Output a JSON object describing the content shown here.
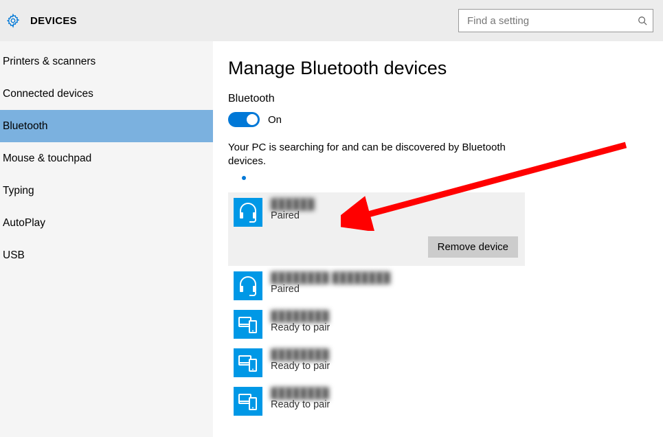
{
  "header": {
    "title": "DEVICES",
    "search_placeholder": "Find a setting"
  },
  "sidebar": {
    "items": [
      {
        "label": "Printers & scanners",
        "selected": false
      },
      {
        "label": "Connected devices",
        "selected": false
      },
      {
        "label": "Bluetooth",
        "selected": true
      },
      {
        "label": "Mouse & touchpad",
        "selected": false
      },
      {
        "label": "Typing",
        "selected": false
      },
      {
        "label": "AutoPlay",
        "selected": false
      },
      {
        "label": "USB",
        "selected": false
      }
    ]
  },
  "main": {
    "page_title": "Manage Bluetooth devices",
    "bluetooth_label": "Bluetooth",
    "toggle_state": "On",
    "status_text": "Your PC is searching for and can be discovered by Bluetooth devices.",
    "remove_label": "Remove device"
  },
  "devices": [
    {
      "name": "██████",
      "status": "Paired",
      "icon": "headset",
      "selected": true
    },
    {
      "name": "████████ ████████",
      "status": "Paired",
      "icon": "headset",
      "selected": false
    },
    {
      "name": "████████",
      "status": "Ready to pair",
      "icon": "phone",
      "selected": false
    },
    {
      "name": "████████",
      "status": "Ready to pair",
      "icon": "phone",
      "selected": false
    },
    {
      "name": "████████",
      "status": "Ready to pair",
      "icon": "phone",
      "selected": false
    }
  ],
  "colors": {
    "accent": "#0078d7",
    "icon_blue": "#0098e6",
    "sidebar_selected": "#7bb1df",
    "arrow": "#ff0000"
  }
}
